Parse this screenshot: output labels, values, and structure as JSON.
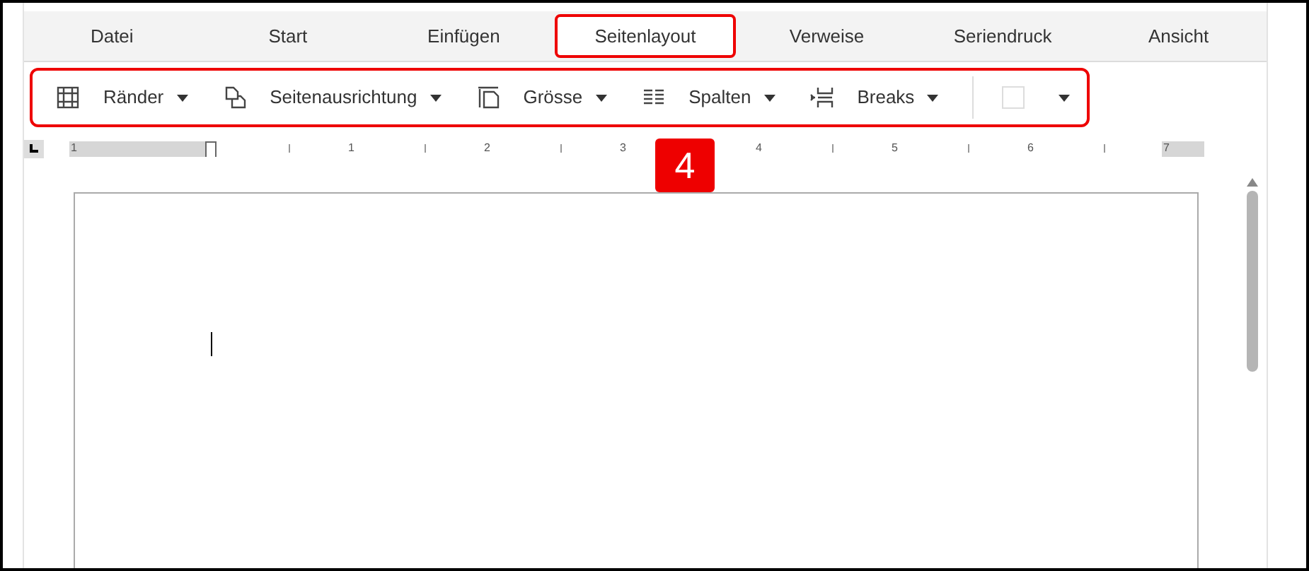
{
  "tabs": [
    {
      "label": "Datei",
      "selected": false
    },
    {
      "label": "Start",
      "selected": false
    },
    {
      "label": "Einfügen",
      "selected": false
    },
    {
      "label": "Seitenlayout",
      "selected": true
    },
    {
      "label": "Verweise",
      "selected": false
    },
    {
      "label": "Seriendruck",
      "selected": false
    },
    {
      "label": "Ansicht",
      "selected": false
    }
  ],
  "toolbar": [
    {
      "kind": "margins",
      "label": "Ränder"
    },
    {
      "kind": "orientation",
      "label": "Seitenausrichtung"
    },
    {
      "kind": "size",
      "label": "Grösse"
    },
    {
      "kind": "columns",
      "label": "Spalten"
    },
    {
      "kind": "breaks",
      "label": "Breaks"
    }
  ],
  "ruler": [
    "1",
    "1",
    "2",
    "3",
    "4",
    "5",
    "6",
    "7"
  ],
  "callout": "4"
}
